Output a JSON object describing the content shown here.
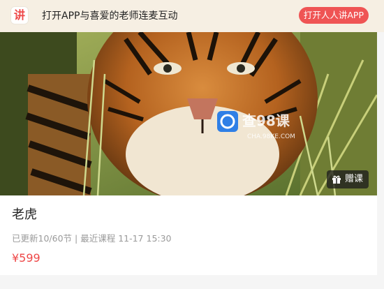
{
  "banner": {
    "logo_char": "讲",
    "text": "打开APP与喜爱的老师连麦互动",
    "open_button": "打开人人讲APP"
  },
  "course": {
    "title": "老虎",
    "updated": "已更新10/60节",
    "separator": "|",
    "recent": "最近课程 11-17 15:30",
    "price": "¥599",
    "gift_button": "赠课"
  },
  "watermark": {
    "brand": "查98课",
    "domain": "CHA.98KE.COM"
  },
  "colors": {
    "accent": "#ef5454",
    "banner_bg": "#f6efe3"
  }
}
